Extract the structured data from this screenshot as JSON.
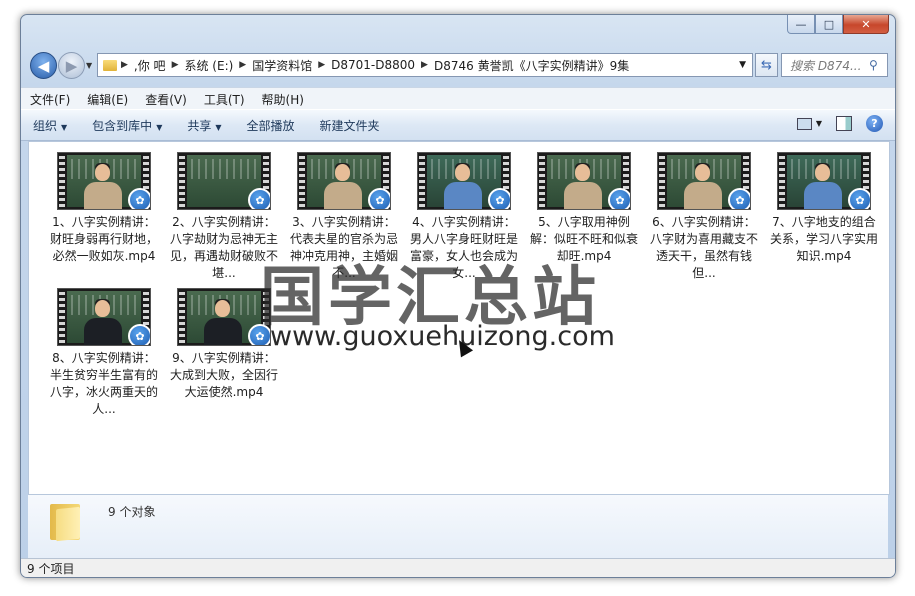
{
  "window": {
    "caption_buttons": {
      "minimize": "—",
      "maximize": "□",
      "close": "✕"
    }
  },
  "nav": {
    "back_icon": "◀",
    "forward_icon": "▶",
    "breadcrumbs": [
      ",你  吧",
      "系统 (E:)",
      "国学资料馆",
      "D8701-D8800",
      "D8746 黄誉凯《八字实例精讲》9集"
    ],
    "search_placeholder": "搜索 D874..."
  },
  "menu": [
    "文件(F)",
    "编辑(E)",
    "查看(V)",
    "工具(T)",
    "帮助(H)"
  ],
  "toolbar": {
    "organize": "组织",
    "include_library": "包含到库中",
    "share": "共享",
    "play_all": "全部播放",
    "new_folder": "新建文件夹"
  },
  "files": [
    {
      "label": "1、八字实例精讲：财旺身弱再行财地，必然一败如灰.mp4",
      "display": "1、八字实例精讲：财旺身弱再行财地，必然一败如灰.mp4"
    },
    {
      "label": "2、八字实例精讲：八字劫财为忌神无主见，再遇劫财破败不堪...",
      "display": "2、八字实例精讲：八字劫财为忌神无主见，再遇劫财破败不堪..."
    },
    {
      "label": "3、八字实例精讲：代表夫星的官杀为忌神冲克用神，主婚姻不...",
      "display": "3、八字实例精讲：代表夫星的官杀为忌神冲克用神，主婚姻不..."
    },
    {
      "label": "4、八字实例精讲：男人八字身旺财旺是富豪，女人也会成为女...",
      "display": "4、八字实例精讲：男人八字身旺财旺是富豪，女人也会成为女..."
    },
    {
      "label": "5、八字取用神例解：似旺不旺和似衰却旺.mp4",
      "display": "5、八字取用神例解：似旺不旺和似衰却旺.mp4"
    },
    {
      "label": "6、八字实例精讲：八字财为喜用藏支不透天干，虽然有钱但...",
      "display": "6、八字实例精讲：八字财为喜用藏支不透天干，虽然有钱但..."
    },
    {
      "label": "7、八字地支的组合关系，学习八字实用知识.mp4",
      "display": "7、八字地支的组合关系，学习八字实用知识.mp4"
    },
    {
      "label": "8、八字实例精讲：半生贫穷半生富有的八字，冰火两重天的人...",
      "display": "8、八字实例精讲：半生贫穷半生富有的八字，冰火两重天的人..."
    },
    {
      "label": "9、八字实例精讲：大成到大败，全因行大运使然.mp4",
      "display": "9、八字实例精讲：大成到大败，全因行大运使然.mp4"
    }
  ],
  "details": {
    "count": "9 个对象"
  },
  "status": {
    "text": "9 个项目"
  },
  "watermark": {
    "title": "国学汇总站",
    "url": "www.guoxuehuizong.com"
  }
}
